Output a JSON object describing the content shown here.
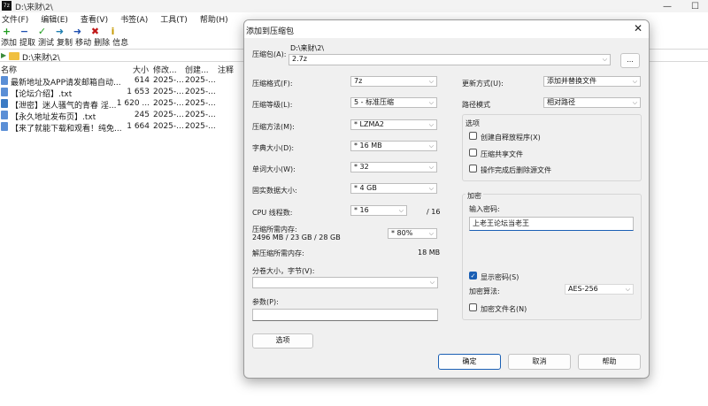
{
  "window": {
    "title": "D:\\来财\\2\\",
    "app_icon_text": "7z",
    "minimize_glyph": "—",
    "maximize_glyph": "☐"
  },
  "menu": [
    "文件(F)",
    "编辑(E)",
    "查看(V)",
    "书签(A)",
    "工具(T)",
    "帮助(H)"
  ],
  "toolbar": {
    "labels": [
      "添加",
      "提取",
      "测试",
      "复制",
      "移动",
      "删除",
      "信息"
    ],
    "icons": [
      {
        "name": "add-icon",
        "glyph": "+",
        "color": "#1f9d1f"
      },
      {
        "name": "extract-icon",
        "glyph": "−",
        "color": "#1f4fb0"
      },
      {
        "name": "test-icon",
        "glyph": "✓",
        "color": "#1f9d1f"
      },
      {
        "name": "copy-icon",
        "glyph": "➜",
        "color": "#1f7fb0"
      },
      {
        "name": "move-icon",
        "glyph": "➜",
        "color": "#1f4fb0"
      },
      {
        "name": "delete-icon",
        "glyph": "✖",
        "color": "#c01818"
      },
      {
        "name": "info-icon",
        "glyph": "i",
        "color": "#c79a00"
      }
    ]
  },
  "address": {
    "path": "D:\\来财\\2\\"
  },
  "columns": {
    "name": "名称",
    "size": "大小",
    "modified": "修改...",
    "created": "创建...",
    "comment": "注释"
  },
  "files": [
    {
      "name": "最新地址及APP请发邮箱自动...",
      "size": "614",
      "modified": "2025-...",
      "created": "2025-..."
    },
    {
      "name": "【论坛介绍】.txt",
      "size": "1 653",
      "modified": "2025-...",
      "created": "2025-..."
    },
    {
      "name": "【泄密】迷人骚气的青春 淫...",
      "size": "1 620 ...",
      "modified": "2025-...",
      "created": "2025-..."
    },
    {
      "name": "【永久地址发布页】.txt",
      "size": "245",
      "modified": "2025-...",
      "created": "2025-..."
    },
    {
      "name": "【来了就能下载和观看！纯免...",
      "size": "1 664",
      "modified": "2025-...",
      "created": "2025-..."
    }
  ],
  "dialog": {
    "title": "添加到压缩包",
    "archive_label": "压缩包(A):",
    "archive_dir": "D:\\来财\\2\\",
    "archive_name": "2.7z",
    "browse_label": "...",
    "format_label": "压缩格式(F):",
    "format_value": "7z",
    "level_label": "压缩等级(L):",
    "level_value": "5 - 标准压缩",
    "method_label": "压缩方法(M):",
    "method_value": "* LZMA2",
    "dict_label": "字典大小(D):",
    "dict_value": "* 16 MB",
    "word_label": "单词大小(W):",
    "word_value": "* 32",
    "solid_label": "固实数据大小:",
    "solid_value": "* 4 GB",
    "threads_label": "CPU 线程数:",
    "threads_value": "* 16",
    "threads_max": "/ 16",
    "mem_comp_label": "压缩所需内存:",
    "mem_comp_value": "2496 MB / 23 GB / 28 GB",
    "mem_percent": "* 80%",
    "mem_decomp_label": "解压缩所需内存:",
    "mem_decomp_value": "18 MB",
    "split_label": "分卷大小，字节(V):",
    "split_value": "",
    "params_label": "参数(P):",
    "params_value": "",
    "options_button": "选项",
    "update_label": "更新方式(U):",
    "update_value": "添加并替换文件",
    "path_label": "路径模式",
    "path_value": "相对路径",
    "options_group": "选项",
    "opt_sfx": "创建自释放程序(X)",
    "opt_shared": "压缩共享文件",
    "opt_delete": "操作完成后删除源文件",
    "enc_group": "加密",
    "pwd_label": "输入密码:",
    "pwd_value": "上老王论坛当老王",
    "show_pwd": "显示密码(S)",
    "enc_method_label": "加密算法:",
    "enc_method_value": "AES-256",
    "enc_names": "加密文件名(N)",
    "ok": "确定",
    "cancel": "取消",
    "help": "帮助",
    "close_glyph": "✕"
  }
}
